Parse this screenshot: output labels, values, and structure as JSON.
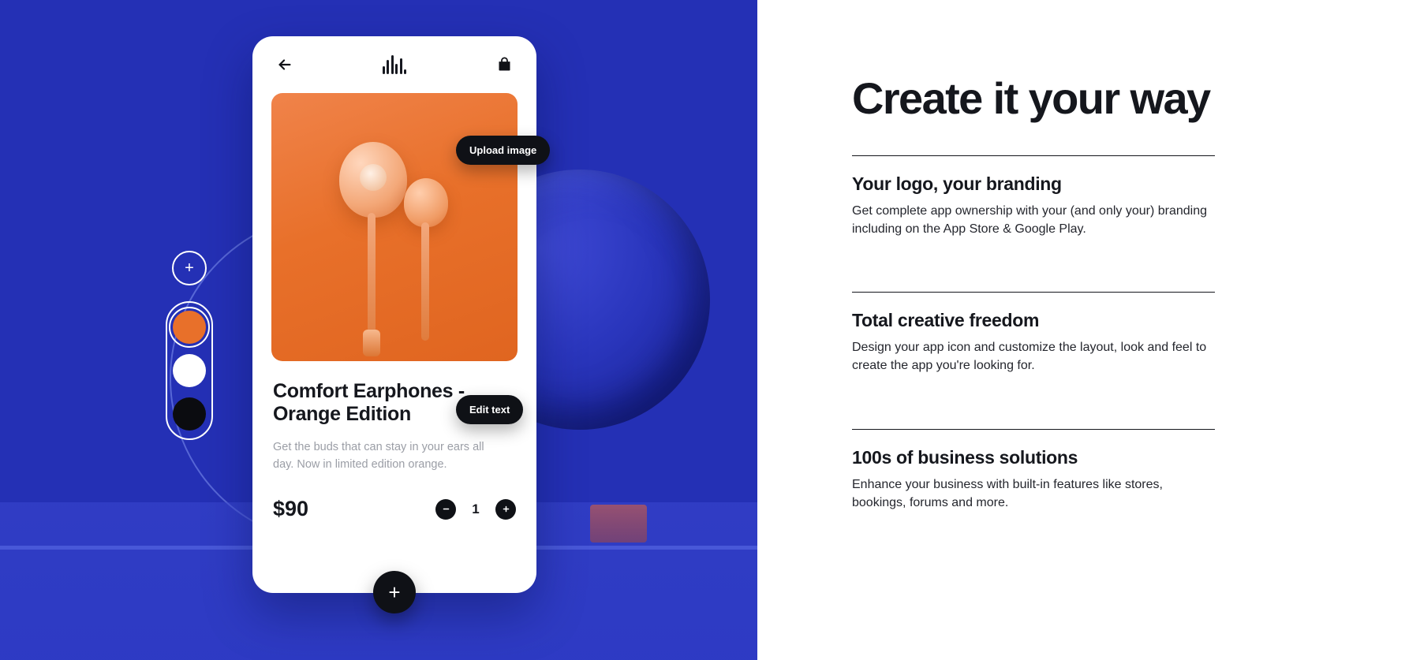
{
  "hero": {
    "phone": {
      "topbar": {
        "back_icon": "arrow-left-icon",
        "brand_icon": "audio-waveform-icon",
        "bag_icon": "shopping-bag-icon"
      },
      "product": {
        "title": "Comfort Earphones - Orange Edition",
        "description": "Get the buds that can stay in your ears all day. Now in limited edition orange.",
        "price": "$90",
        "quantity": "1",
        "decrease_label": "–",
        "increase_label": "+",
        "image_alt": "orange-earphones"
      },
      "fab_label": "+"
    },
    "overlays": {
      "upload_image": "Upload image",
      "edit_text": "Edit text"
    },
    "color_picker": {
      "add_label": "+",
      "swatches": [
        {
          "name": "orange",
          "hex": "#e8702a",
          "selected": true
        },
        {
          "name": "white",
          "hex": "#ffffff",
          "selected": false
        },
        {
          "name": "black",
          "hex": "#0b0c10",
          "selected": false
        }
      ]
    },
    "colors": {
      "background": "#2430b5",
      "accent": "#e8702a"
    }
  },
  "content": {
    "headline": "Create it your way",
    "features": [
      {
        "title": "Your logo, your branding",
        "body": "Get complete app ownership with your (and only your) branding including on the App Store & Google Play."
      },
      {
        "title": "Total creative freedom",
        "body": "Design your app icon and customize the layout, look and feel to create the app you're looking for."
      },
      {
        "title": "100s of business solutions",
        "body": "Enhance your business with built-in features like stores, bookings, forums and more."
      }
    ]
  }
}
